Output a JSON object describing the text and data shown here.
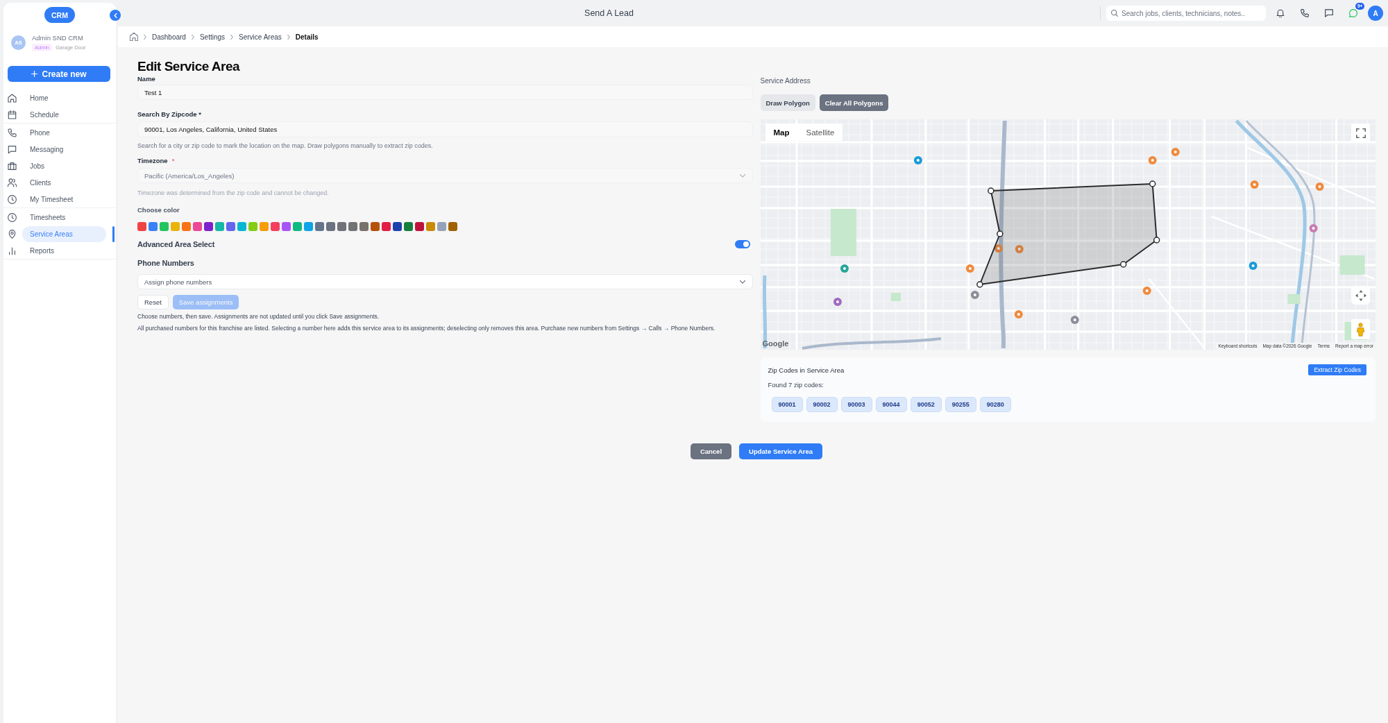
{
  "header": {
    "title": "Send A Lead",
    "search": {
      "placeholder": "Search jobs, clients, technicians, notes.."
    },
    "chat_badge": "9+",
    "avatar": "A"
  },
  "sidebar": {
    "logo": "CRM",
    "user": {
      "initials": "AS",
      "name": "Admin SND CRM",
      "role": "Admin",
      "company": "Garage Door"
    },
    "create_button": "Create new",
    "sections": [
      {
        "items": [
          {
            "label": "Home",
            "selected": false
          },
          {
            "label": "Schedule",
            "selected": false
          }
        ]
      },
      {
        "items": [
          {
            "label": "Phone",
            "selected": false
          },
          {
            "label": "Messaging",
            "selected": false
          },
          {
            "label": "Jobs",
            "selected": false
          },
          {
            "label": "Clients",
            "selected": false
          },
          {
            "label": "My Timesheet",
            "selected": false
          }
        ]
      },
      {
        "items": [
          {
            "label": "Timesheets",
            "selected": false
          },
          {
            "label": "Service Areas",
            "selected": true
          },
          {
            "label": "Reports",
            "selected": false
          }
        ]
      }
    ]
  },
  "breadcrumb": [
    {
      "label": "Dashboard",
      "current": false
    },
    {
      "label": "Settings",
      "current": false
    },
    {
      "label": "Service Areas",
      "current": false
    },
    {
      "label": "Details",
      "current": true
    }
  ],
  "form": {
    "title": "Edit Service Area",
    "name": {
      "label": "Name",
      "value": "Test 1"
    },
    "zipcode": {
      "label": "Search By Zipcode *",
      "value": "90001, Los Angeles, California, United States",
      "help": "Search for a city or zip code to mark the location on the map. Draw polygons manually to extract zip codes."
    },
    "timezone": {
      "label": "Timezone",
      "required_mark": "*",
      "value": "Pacific (America/Los_Angeles)",
      "disabled": true,
      "help": "Timezone was determined from the zip code and cannot be changed."
    },
    "color_picker": {
      "label": "Choose color",
      "swatches": [
        {
          "color": "#ef4444",
          "selected": false
        },
        {
          "color": "#3b82f6",
          "selected": false
        },
        {
          "color": "#22c55e",
          "selected": false
        },
        {
          "color": "#eab308",
          "selected": false
        },
        {
          "color": "#f97316",
          "selected": false
        },
        {
          "color": "#ec4899",
          "selected": false
        },
        {
          "color": "#7e22ce",
          "selected": false
        },
        {
          "color": "#14b8a6",
          "selected": false
        },
        {
          "color": "#6366f1",
          "selected": false
        },
        {
          "color": "#06b6d4",
          "selected": false
        },
        {
          "color": "#84cc16",
          "selected": false
        },
        {
          "color": "#f59e0b",
          "selected": false
        },
        {
          "color": "#f43f5e",
          "selected": false
        },
        {
          "color": "#a855f7",
          "selected": false
        },
        {
          "color": "#10b981",
          "selected": false
        },
        {
          "color": "#0ea5e9",
          "selected": false
        },
        {
          "color": "#64748b",
          "selected": false
        },
        {
          "color": "#6b7280",
          "selected": false
        },
        {
          "color": "#71717a",
          "selected": false
        },
        {
          "color": "#737373",
          "selected": false
        },
        {
          "color": "#78716c",
          "selected": false
        },
        {
          "color": "#b45309",
          "selected": false
        },
        {
          "color": "#e11d48",
          "selected": false
        },
        {
          "color": "#1e40af",
          "selected": false
        },
        {
          "color": "#15803d",
          "selected": false
        },
        {
          "color": "#be123c",
          "selected": false
        },
        {
          "color": "#ca8a04",
          "selected": false
        },
        {
          "color": "#94a3b8",
          "selected": false
        },
        {
          "color": "#a16207",
          "selected": false
        }
      ]
    },
    "advanced_area_select": {
      "label": "Advanced Area Select",
      "on": true
    },
    "phone_numbers": {
      "label": "Phone Numbers",
      "select": {
        "placeholder": "Assign phone numbers"
      },
      "buttons": [
        {
          "label": "Reset",
          "kind": "outline",
          "disabled": false
        },
        {
          "label": "Save assignments",
          "kind": "primary",
          "disabled": true
        }
      ],
      "notes": [
        "Choose numbers, then save. Assignments are not updated until you click Save assignments.",
        "All purchased numbers for this franchise are listed. Selecting a number here adds this service area to its assignments; deselecting only removes this area. Purchase new numbers from Settings → Calls → Phone Numbers."
      ]
    }
  },
  "service_address": {
    "label": "Service Address",
    "buttons": [
      {
        "label": "Draw Polygon",
        "kind": "light"
      },
      {
        "label": "Clear All Polygons",
        "kind": "dark"
      }
    ],
    "map": {
      "types": [
        {
          "label": "Map",
          "selected": true
        },
        {
          "label": "Satellite",
          "selected": false
        }
      ],
      "logo": "Google",
      "attribution": [
        "Keyboard shortcuts",
        "Map data ©2026 Google",
        "Terms",
        "Report a map error"
      ]
    }
  },
  "zip_codes": {
    "title": "Zip Codes in Service Area",
    "extract_button": "Extract Zip Codes",
    "summary": "Found 7 zip codes:",
    "codes": [
      "90001",
      "90002",
      "90003",
      "90044",
      "90052",
      "90255",
      "90280"
    ]
  },
  "actions": [
    {
      "label": "Cancel",
      "kind": "dark"
    },
    {
      "label": "Update Service Area",
      "kind": "primary"
    }
  ]
}
